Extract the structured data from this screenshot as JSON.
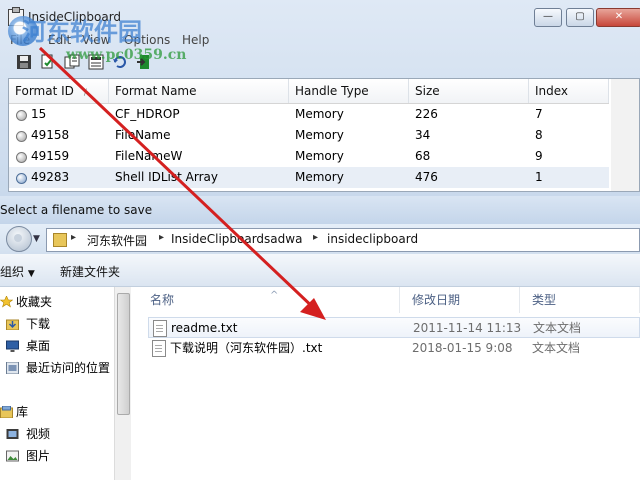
{
  "top_window": {
    "title": "InsideClipboard",
    "menu": [
      "File",
      "Edit",
      "View",
      "Options",
      "Help"
    ],
    "minimize_glyph": "—",
    "maximize_glyph": "▢",
    "close_glyph": "✕",
    "toolbar_icons": [
      "save-icon",
      "copy-icon",
      "properties-icon",
      "html-report-icon",
      "refresh-icon",
      "exit-icon"
    ],
    "columns": [
      "Format ID",
      "Format Name",
      "Handle Type",
      "Size",
      "Index"
    ],
    "rows": [
      {
        "id": "15",
        "name": "CF_HDROP",
        "handle": "Memory",
        "size": "226",
        "index": "7"
      },
      {
        "id": "49158",
        "name": "FileName",
        "handle": "Memory",
        "size": "34",
        "index": "8"
      },
      {
        "id": "49159",
        "name": "FileNameW",
        "handle": "Memory",
        "size": "68",
        "index": "9"
      },
      {
        "id": "49283",
        "name": "Shell IDList Array",
        "handle": "Memory",
        "size": "476",
        "index": "1"
      }
    ]
  },
  "watermark": {
    "line1": "河东软件园",
    "line2": "www.pc0359.cn"
  },
  "save_dialog": {
    "title": "Select a filename to save",
    "breadcrumb": [
      "河东软件园",
      "InsideClipboardsadwa",
      "insideclipboard"
    ],
    "organize_label": "组织",
    "new_folder_label": "新建文件夹",
    "nav_items": [
      {
        "label": "收藏夹",
        "icon": "star-icon"
      },
      {
        "label": "下载",
        "icon": "download-folder-icon"
      },
      {
        "label": "桌面",
        "icon": "desktop-icon"
      },
      {
        "label": "最近访问的位置",
        "icon": "recent-places-icon"
      },
      {
        "label": "库",
        "icon": "library-icon"
      },
      {
        "label": "视频",
        "icon": "video-library-icon"
      },
      {
        "label": "图片",
        "icon": "picture-library-icon"
      }
    ],
    "file_columns": [
      "名称",
      "修改日期",
      "类型"
    ],
    "files": [
      {
        "name": "readme.txt",
        "date": "2011-11-14 11:13",
        "type": "文本文档"
      },
      {
        "name": "下载说明（河东软件园）.txt",
        "date": "2018-01-15 9:08",
        "type": "文本文档"
      }
    ]
  },
  "colors": {
    "annotation_arrow": "#d42020",
    "title_gradient_top": "#dfe9f5",
    "selection": "#e8eef6"
  }
}
